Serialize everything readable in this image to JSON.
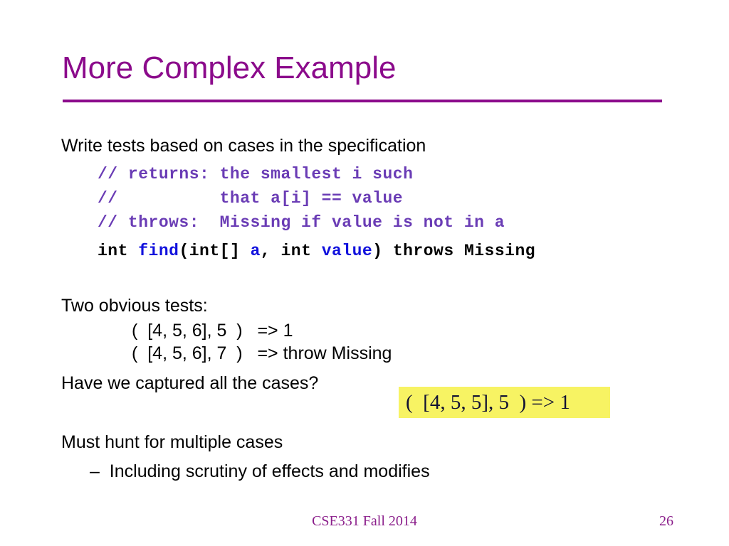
{
  "slide": {
    "title": "More Complex Example",
    "accent_color": "#8B0A8B",
    "comment_color": "#6A3CB5",
    "identifier_color": "#1111DD",
    "highlight_bg": "#F7F363"
  },
  "body": {
    "intro": "Write tests based on cases in the specification",
    "two_tests_label": "Two obvious tests:",
    "captured_question": "Have we captured all the cases?",
    "must_hunt": "Must hunt for multiple cases",
    "including_scrutiny": "–  Including scrutiny of effects and modifies"
  },
  "code": {
    "comment_line_1_prefix": "// ",
    "comment_line_1": "// returns: the smallest i such",
    "comment_line_2": "//          that a[i] == value",
    "comment_line_3": "// throws:  Missing if value is not in a",
    "signature": {
      "part_1": "int ",
      "name": "find",
      "part_2": "(int[] ",
      "arg_1": "a",
      "part_3": ", int ",
      "arg_2": "value",
      "part_4": ") throws Missing"
    }
  },
  "tests": [
    {
      "call": "(  [4, 5, 6], 5  )",
      "arrow": "   => 1"
    },
    {
      "call": "(  [4, 5, 6], 7  )",
      "arrow": "   => throw Missing"
    }
  ],
  "highlight": {
    "text": "(  [4, 5, 5], 5  ) => 1"
  },
  "footer": {
    "course": "CSE331 Fall 2014",
    "page_number": "26"
  }
}
